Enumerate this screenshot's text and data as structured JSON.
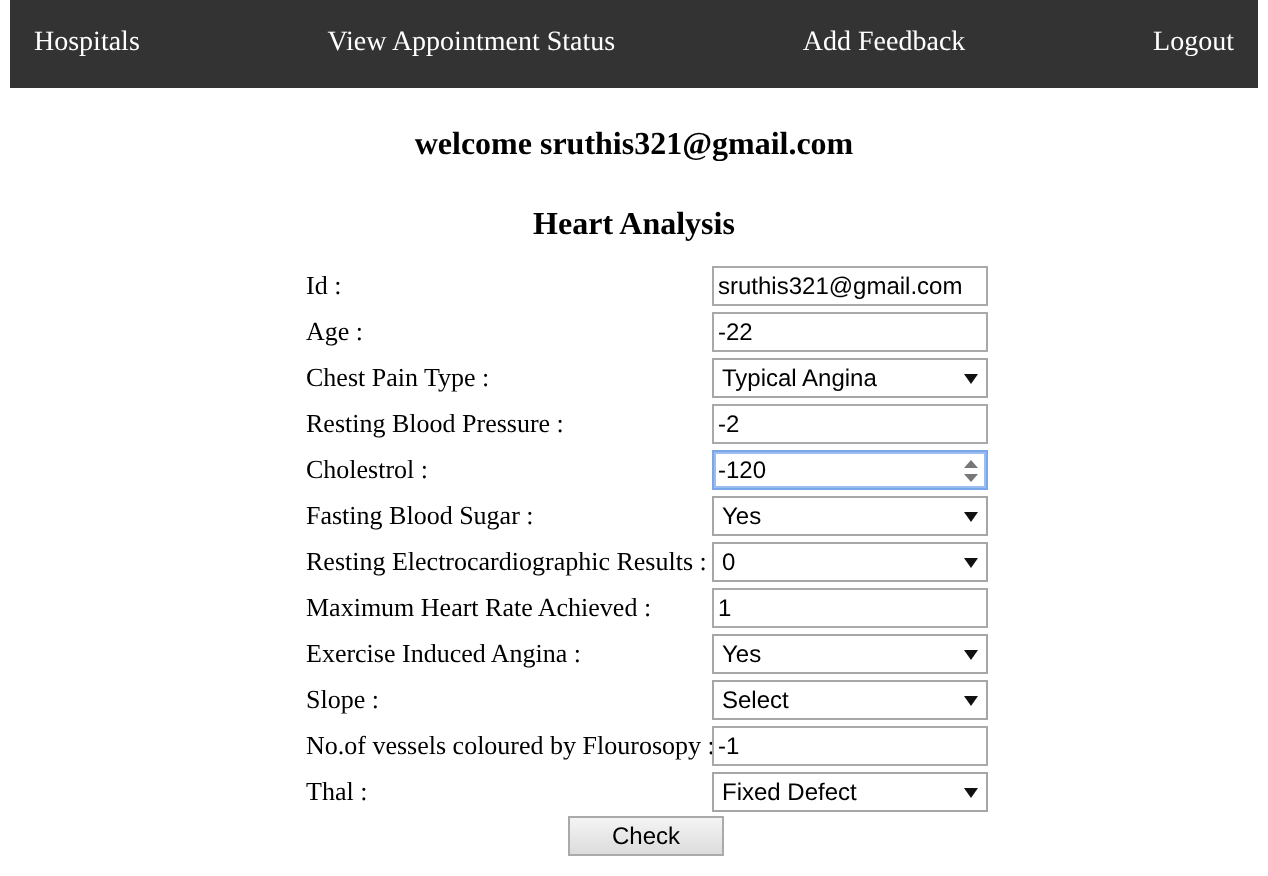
{
  "nav": [
    {
      "label": "Hospitals"
    },
    {
      "label": "View Appointment Status"
    },
    {
      "label": "Add Feedback"
    },
    {
      "label": "Logout"
    }
  ],
  "welcome": "welcome sruthis321@gmail.com",
  "heading": "Heart Analysis",
  "fields": [
    {
      "label": "Id :",
      "kind": "text",
      "value": "sruthis321@gmail.com",
      "focused": false
    },
    {
      "label": "Age :",
      "kind": "text",
      "value": "-22",
      "focused": false
    },
    {
      "label": "Chest Pain Type :",
      "kind": "select",
      "value": "Typical Angina",
      "focused": false
    },
    {
      "label": "Resting Blood Pressure :",
      "kind": "text",
      "value": "-2",
      "focused": false
    },
    {
      "label": "Cholestrol :",
      "kind": "number",
      "value": "-120",
      "focused": true
    },
    {
      "label": "Fasting Blood Sugar :",
      "kind": "select",
      "value": "Yes",
      "focused": false
    },
    {
      "label": "Resting Electrocardiographic Results :",
      "kind": "select",
      "value": "0",
      "focused": false
    },
    {
      "label": "Maximum Heart Rate Achieved :",
      "kind": "text",
      "value": "1",
      "focused": false
    },
    {
      "label": "Exercise Induced Angina :",
      "kind": "select",
      "value": "Yes",
      "focused": false
    },
    {
      "label": "Slope :",
      "kind": "select",
      "value": "Select",
      "focused": false
    },
    {
      "label": "No.of vessels coloured by Flourosopy :",
      "kind": "text",
      "value": "-1",
      "focused": false
    },
    {
      "label": "Thal :",
      "kind": "select",
      "value": "Fixed Defect",
      "focused": false
    }
  ],
  "button": "Check"
}
